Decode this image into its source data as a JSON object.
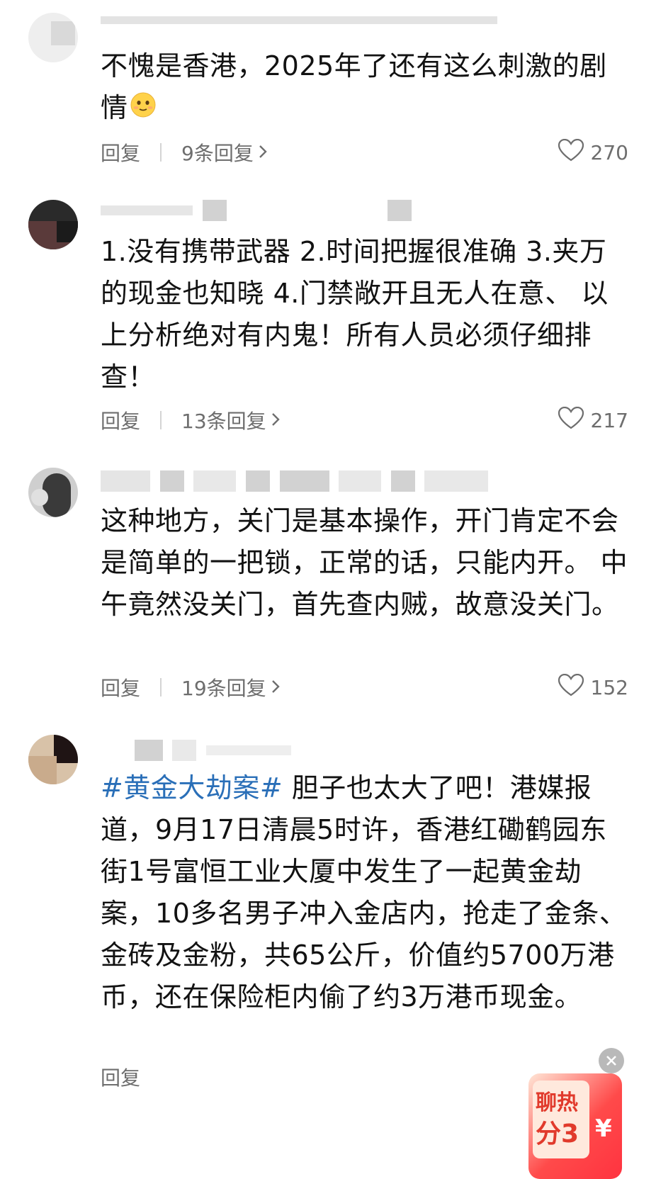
{
  "comments": [
    {
      "content": "不愧是香港，2025年了还有这么刺激的剧情",
      "reply_label": "回复",
      "replies": "9条回复",
      "likes": "270"
    },
    {
      "content": "1.没有携带武器 2.时间把握很准确 3.夹万的现金也知晓 4.门禁敞开且无人在意、 以上分析绝对有内鬼！所有人员必须仔细排查！",
      "reply_label": "回复",
      "replies": "13条回复",
      "likes": "217"
    },
    {
      "content": "这种地方，关门是基本操作，开门肯定不会是简单的一把锁，正常的话，只能内开。 中午竟然没关门，首先查内贼，故意没关门。",
      "reply_label": "回复",
      "replies": "19条回复",
      "likes": "152"
    },
    {
      "hashtag": "#黄金大劫案#",
      "content": " 胆子也太大了吧！港媒报道，9月17日清晨5时许，香港红磡鹤园东街1号富恒工业大厦中发生了一起黄金劫案，10多名男子冲入金店内，抢走了金条、金砖及金粉，共65公斤，价值约5700万港币，还在保险柜内偷了约3万港币现金。",
      "reply_label": "回复"
    }
  ],
  "red_packet": {
    "line1": "聊热",
    "line2": "分3",
    "currency_symbol": "¥"
  },
  "colors": {
    "hashtag": "#2a6fb8",
    "meta_text": "#c9c9c9",
    "action_text": "#6e6e6e",
    "red_packet": "#ff3340"
  },
  "icons": [
    "heart-icon",
    "chevron-right-icon",
    "close-icon",
    "smiling-emoji-icon"
  ]
}
